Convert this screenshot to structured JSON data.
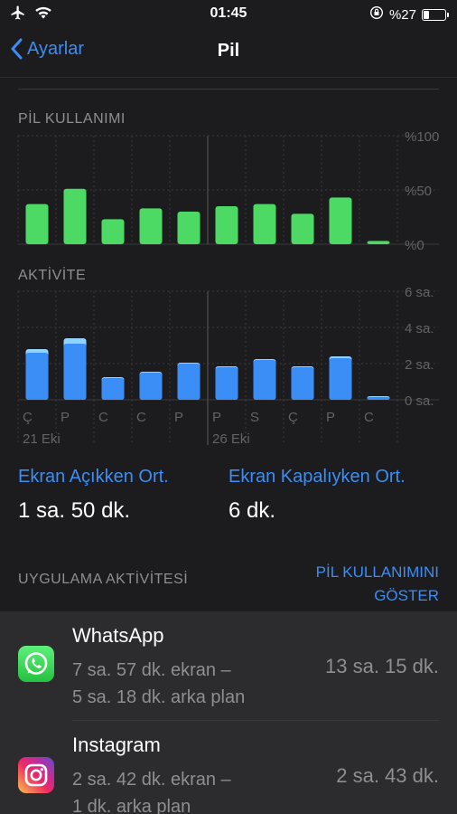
{
  "status_bar": {
    "time": "01:45",
    "battery_text": "%27",
    "battery_level": 0.27,
    "icons": [
      "airplane-icon",
      "wifi-icon",
      "rotation-lock-icon",
      "battery-icon"
    ]
  },
  "nav": {
    "back_label": "Ayarlar",
    "title": "Pil"
  },
  "battery_usage": {
    "title": "PİL KULLANIMI",
    "y_ticks": [
      "%100",
      "%50",
      "%0"
    ],
    "bar_color": "#4cd964"
  },
  "activity": {
    "title": "AKTİVİTE",
    "y_ticks": [
      "6 sa.",
      "4 sa.",
      "2 sa.",
      "0 sa."
    ],
    "screen_on_color": "#3a8ef6",
    "screen_off_color": "#8fd3fe"
  },
  "chart_data": [
    {
      "type": "bar",
      "title": "PİL KULLANIMI",
      "categories": [
        "Ç",
        "P",
        "C",
        "C",
        "P",
        "P",
        "S",
        "Ç",
        "P",
        "C"
      ],
      "values": [
        37,
        51,
        23,
        33,
        30,
        35,
        37,
        28,
        43,
        3
      ],
      "ylim": [
        0,
        100
      ]
    },
    {
      "type": "bar",
      "title": "AKTİVİTE",
      "categories": [
        "Ç",
        "P",
        "C",
        "C",
        "P",
        "P",
        "S",
        "Ç",
        "P",
        "C"
      ],
      "series": [
        {
          "values": [
            2.6,
            3.1,
            1.2,
            1.5,
            2.0,
            1.8,
            2.2,
            1.8,
            2.3,
            0.15
          ]
        },
        {
          "values": [
            0.2,
            0.3,
            0.05,
            0.05,
            0.05,
            0.05,
            0.05,
            0.05,
            0.1,
            0.05
          ]
        }
      ],
      "ylim": [
        0,
        6
      ],
      "x_group_labels": [
        "21 Eki",
        "26 Eki"
      ]
    }
  ],
  "averages": {
    "screen_on_label": "Ekran Açıkken Ort.",
    "screen_on_value": "1 sa. 50 dk.",
    "screen_off_label": "Ekran Kapalıyken Ort.",
    "screen_off_value": "6 dk."
  },
  "app_activity": {
    "header": "UYGULAMA AKTİVİTESİ",
    "link_line1": "PİL KULLANIMINI",
    "link_line2": "GÖSTER"
  },
  "apps": [
    {
      "name": "WhatsApp",
      "detail_line1": "7 sa. 57 dk. ekran –",
      "detail_line2": "5 sa. 18 dk. arka plan",
      "total": "13 sa. 15 dk."
    },
    {
      "name": "Instagram",
      "detail_line1": "2 sa. 42 dk. ekran –",
      "detail_line2": "1 dk. arka plan",
      "total": "2 sa. 43 dk."
    }
  ]
}
